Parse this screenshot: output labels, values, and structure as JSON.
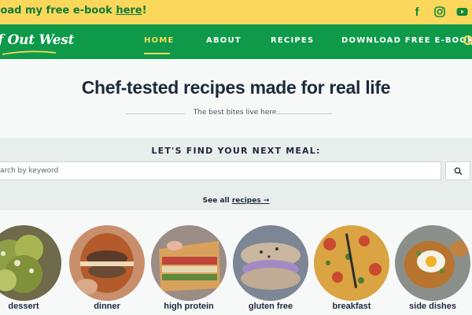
{
  "topbar": {
    "promo_text": "load my free e-book ",
    "promo_link": "here",
    "promo_end": "!",
    "social": [
      "facebook-icon",
      "instagram-icon",
      "youtube-icon"
    ]
  },
  "nav": {
    "logo": "f Out West",
    "items": [
      {
        "label": "HOME",
        "active": true
      },
      {
        "label": "ABOUT",
        "active": false
      },
      {
        "label": "RECIPES",
        "active": false
      },
      {
        "label": "DOWNLOAD FREE E-BOOK",
        "active": false
      }
    ]
  },
  "hero": {
    "title": "Chef-tested recipes made for real life",
    "tagline": "The best bites live here."
  },
  "search": {
    "heading": "LET'S FIND YOUR NEXT MEAL:",
    "placeholder": "arch by keyword",
    "see_all_prefix": "See all ",
    "see_all_link": "recipes →"
  },
  "categories": [
    {
      "label": "dessert"
    },
    {
      "label": "dinner"
    },
    {
      "label": "high protein"
    },
    {
      "label": "gluten free"
    },
    {
      "label": "breakfast"
    },
    {
      "label": "side dishes"
    }
  ],
  "colors": {
    "topbar_bg": "#fbd85b",
    "nav_bg": "#0f9a4a",
    "accent": "#fbd85b",
    "text_dark": "#1e2a3a"
  }
}
